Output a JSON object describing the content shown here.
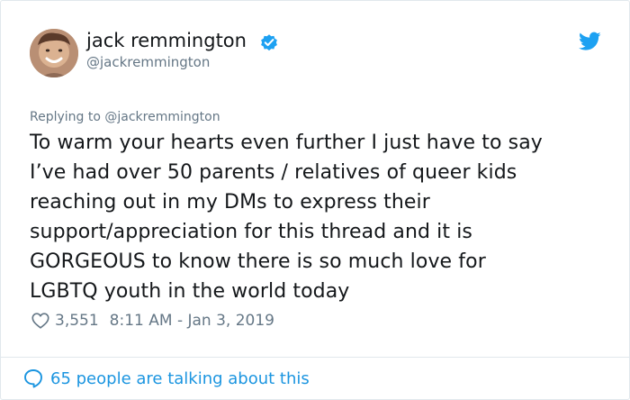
{
  "author": {
    "name": "jack remmington",
    "handle": "@jackremmington",
    "verified_icon": "verified-badge-icon",
    "avatar_icon": "avatar"
  },
  "brand": {
    "logo_icon": "twitter-bird-icon",
    "accent": "#1da1f2"
  },
  "reply": {
    "label": "Replying to @jackremmington"
  },
  "tweet": {
    "lines": [
      "To warm your hearts even further I just have to say",
      "I’ve had over 50 parents / relatives of queer kids",
      "reaching out in my DMs to express their",
      "support/appreciation for this thread and it is",
      "GORGEOUS to know there is so much love for",
      "LGBTQ youth in the world today"
    ],
    "likes": "3,551",
    "timestamp": "8:11 AM - Jan 3, 2019",
    "heart_icon": "heart-icon"
  },
  "footer": {
    "conversation_label": "65 people are talking about this",
    "bubble_icon": "speech-bubble-icon",
    "link_color": "#1b95e0"
  }
}
